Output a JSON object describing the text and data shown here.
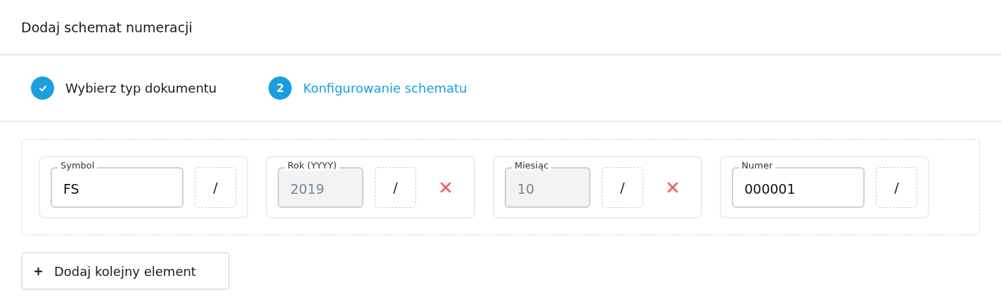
{
  "dialog": {
    "title": "Dodaj schemat numeracji"
  },
  "steps": [
    {
      "label": "Wybierz typ dokumentu",
      "done": true,
      "active": false
    },
    {
      "label": "Konfigurowanie schematu",
      "number": "2",
      "done": false,
      "active": true
    }
  ],
  "segments": [
    {
      "label": "Symbol",
      "value": "FS",
      "disabled": false,
      "separator": "/",
      "removable": false
    },
    {
      "label": "Rok (YYYY)",
      "value": "2019",
      "disabled": true,
      "separator": "/",
      "removable": true
    },
    {
      "label": "Miesiąc",
      "value": "10",
      "disabled": true,
      "separator": "/",
      "removable": true
    },
    {
      "label": "Numer",
      "value": "000001",
      "disabled": false,
      "separator": "/",
      "removable": false
    }
  ],
  "add_button": {
    "label": "Dodaj kolejny element"
  }
}
